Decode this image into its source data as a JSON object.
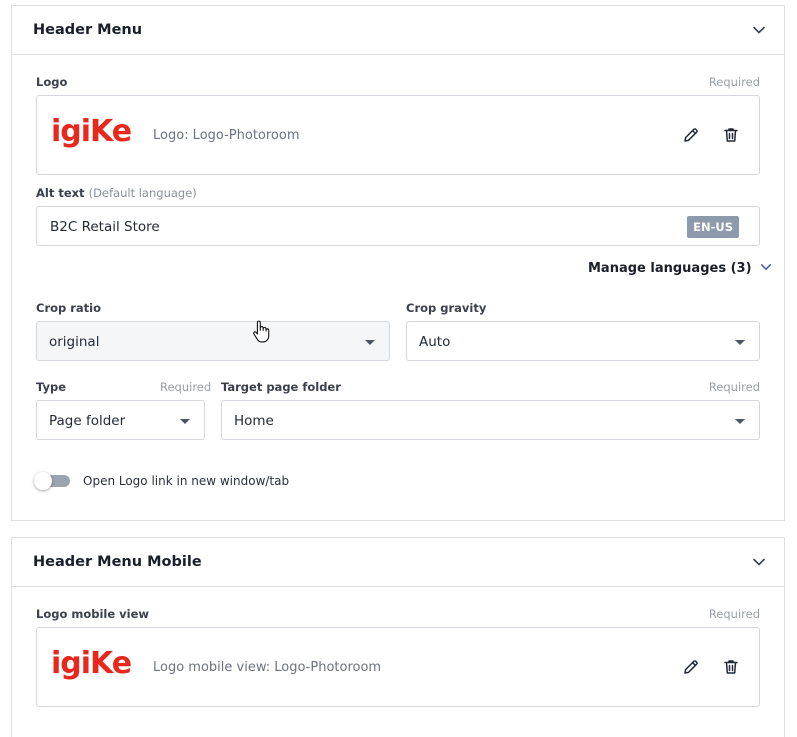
{
  "header_menu": {
    "title": "Header Menu",
    "logo": {
      "label": "Logo",
      "required": "Required",
      "logo_text": "igiKe",
      "caption": "Logo: Logo-Photoroom"
    },
    "alt_text": {
      "label": "Alt text",
      "hint": "(Default language)",
      "value": "B2C Retail Store",
      "language_badge": "EN-US"
    },
    "manage_languages": "Manage languages (3)",
    "crop_ratio": {
      "label": "Crop ratio",
      "value": "original"
    },
    "crop_gravity": {
      "label": "Crop gravity",
      "value": "Auto"
    },
    "type": {
      "label": "Type",
      "required": "Required",
      "value": "Page folder"
    },
    "target_page_folder": {
      "label": "Target page folder",
      "required": "Required",
      "value": "Home"
    },
    "open_new_window": {
      "label": "Open Logo link in new window/tab",
      "enabled": false
    }
  },
  "header_menu_mobile": {
    "title": "Header Menu Mobile",
    "logo": {
      "label": "Logo mobile view",
      "required": "Required",
      "logo_text": "igiKe",
      "caption": "Logo mobile view: Logo-Photoroom"
    }
  },
  "icons": [
    "chevron-down-icon",
    "pencil-icon",
    "trash-icon",
    "caret-down-icon",
    "hand-pointer-icon"
  ],
  "colors": {
    "brand_logo": "#e8281d",
    "badge": "#8c9aab",
    "toggle_off": "#9ca3af"
  }
}
